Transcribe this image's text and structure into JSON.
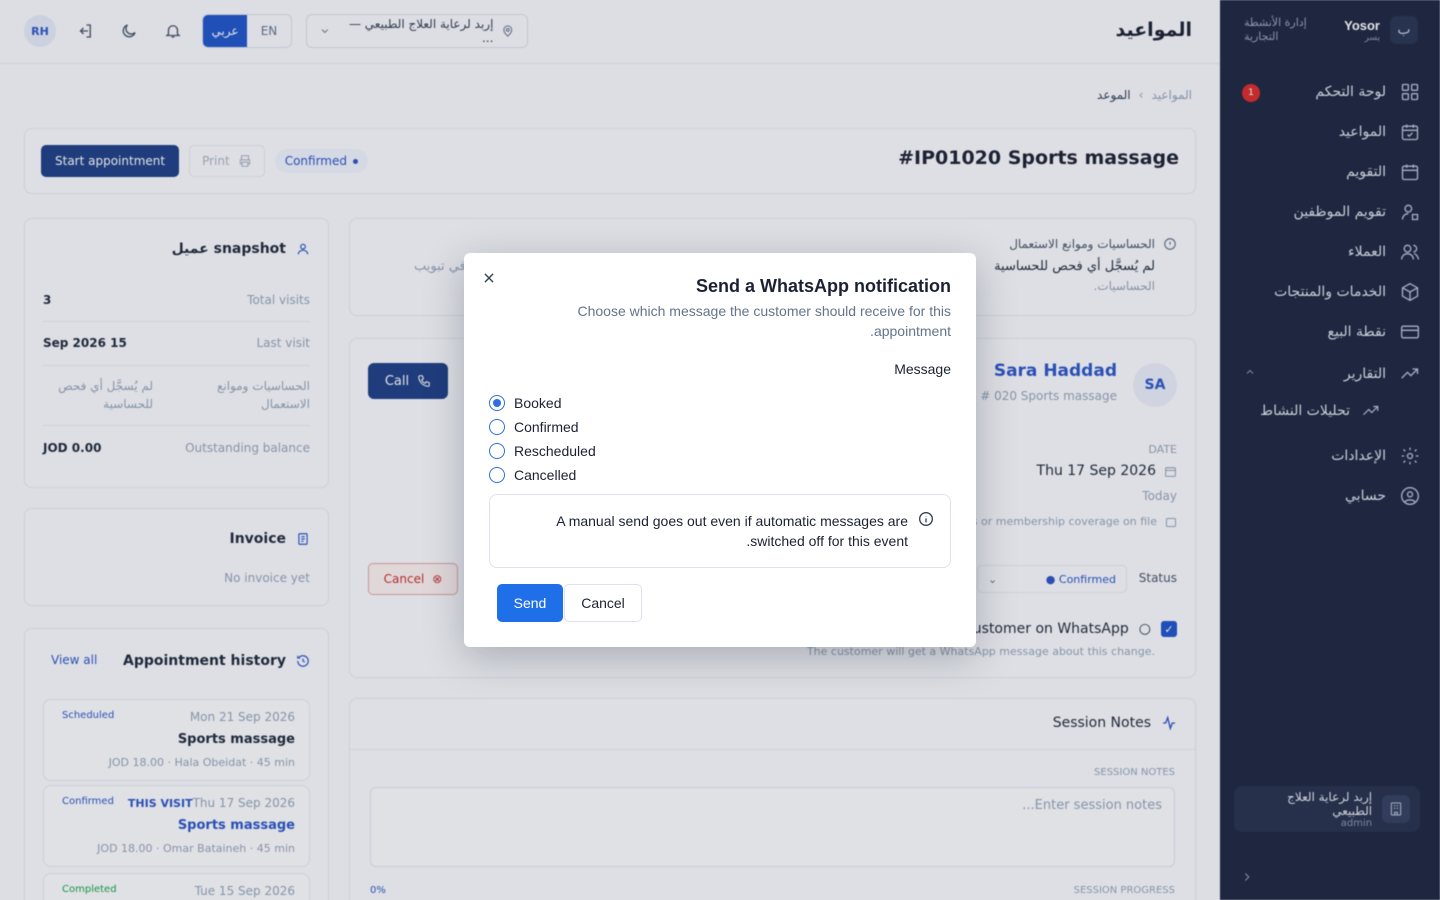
{
  "brand": {
    "name": "Yosor",
    "sub": "يسر",
    "tagline": "إدارة الأنشطة التجارية"
  },
  "sidebar": {
    "items": [
      {
        "label": "لوحة التحكم",
        "icon": "dashboard-icon",
        "badge": "1"
      },
      {
        "label": "المواعيد",
        "icon": "calendar-check-icon"
      },
      {
        "label": "التقويم",
        "icon": "calendar-icon"
      },
      {
        "label": "تقويم الموظفين",
        "icon": "user-calendar-icon"
      },
      {
        "label": "العملاء",
        "icon": "users-icon"
      },
      {
        "label": "الخدمات والمنتجات",
        "icon": "box-icon"
      },
      {
        "label": "نقطة البيع",
        "icon": "card-icon"
      },
      {
        "label": "التقارير",
        "icon": "trend-icon"
      },
      {
        "label": "الإعدادات",
        "icon": "gear-icon"
      },
      {
        "label": "حسابي",
        "icon": "account-icon"
      }
    ],
    "sub_item": "تحليلات النشاط",
    "footer": {
      "name": "إربد لرعاية العلاج الطبيعي",
      "role": "admin"
    }
  },
  "topbar": {
    "title": "المواعيد",
    "avatar": "RH",
    "lang": {
      "ar": "عربي",
      "en": "EN"
    },
    "location": "إربد لرعاية العلاج الطبيعي — ..."
  },
  "breadcrumb": {
    "parent": "المواعيد",
    "current": "الموعد"
  },
  "header": {
    "title": "#IP01020 Sports massage",
    "start": "Start appointment",
    "print": "Print",
    "status": "Confirmed"
  },
  "snapshot": {
    "title": "snapshot عميل",
    "rows": [
      {
        "label": "Total visits",
        "value": "3"
      },
      {
        "label": "Last visit",
        "value": "Sep 2026 15"
      },
      {
        "label": "الحساسيات وموانع الاستعمال",
        "value": "لم يُسجَّل أي فحص للحساسية"
      },
      {
        "label": "Outstanding balance",
        "value": "JOD 0.00"
      }
    ]
  },
  "invoice": {
    "title": "Invoice",
    "empty": "No invoice yet"
  },
  "history": {
    "title": "Appointment history",
    "view_all": "View all",
    "items": [
      {
        "status": "Scheduled",
        "date": "Mon 21 Sep 2026",
        "name": "Sports massage",
        "meta": "JOD 18.00 · Hala Obeidat · 45 min"
      },
      {
        "status": "Confirmed",
        "tag": "THIS VISIT",
        "date": "Thu 17 Sep 2026",
        "name": "Sports massage",
        "meta": "JOD 18.00 · Omar Bataineh · 45 min"
      },
      {
        "status": "Completed",
        "date": "Tue 15 Sep 2026"
      }
    ]
  },
  "allergy": {
    "title": "الحساسيات وموانع الاستعمال",
    "text": "لم يُسجَّل أي فحص للحساسية",
    "text2": "الحساسيات.",
    "side": "في تبويب"
  },
  "client": {
    "initials": "SA",
    "name": "Sara Haddad",
    "sub": "# 020 Sports massage",
    "call": "Call",
    "date_label": "DATE",
    "date": "Thu 17 Sep 2026",
    "today": "Today",
    "coverage": "s or membership coverage on file",
    "status_label": "Status",
    "status": "Confirmed",
    "cancel": "Cancel",
    "wa_label": "customer on WhatsApp",
    "wa_note": "The customer will get a WhatsApp message about this change."
  },
  "notes": {
    "title": "Session Notes",
    "notes_label": "SESSION NOTES",
    "placeholder": "Enter session notes...",
    "progress_label": "SESSION PROGRESS",
    "progress": "0%"
  },
  "modal": {
    "title": "Send a WhatsApp notification",
    "description": "Choose which message the customer should receive for this appointment.",
    "message_label": "Message",
    "options": [
      "Booked",
      "Confirmed",
      "Rescheduled",
      "Cancelled"
    ],
    "selected": "Booked",
    "notice": "A manual send goes out even if automatic messages are switched off for this event.",
    "send": "Send",
    "cancel": "Cancel"
  },
  "colors": {
    "primary": "#1f6fe8",
    "sidebar": "#1e2740",
    "navy": "#1f3f86"
  }
}
